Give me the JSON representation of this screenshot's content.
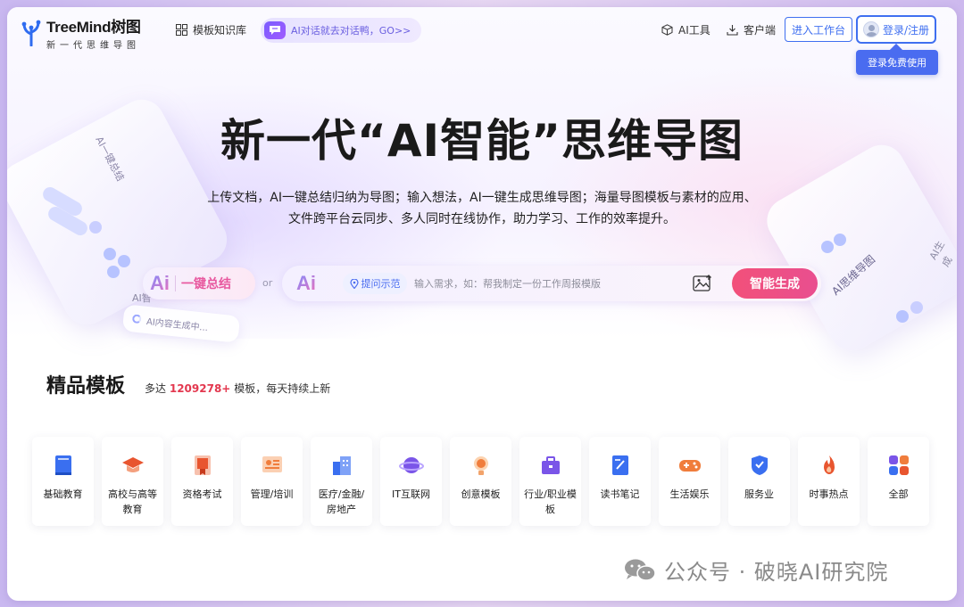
{
  "header": {
    "logo_name": "TreeMind",
    "logo_cn": "树图",
    "logo_tagline": "新一代思维导图",
    "nav_kb": "模板知识库",
    "ai_chat": "AI对话就去对话鸭，GO>>",
    "nav_ai_tools": "AI工具",
    "nav_client": "客户端",
    "workbench_button": "进入工作台",
    "login_button": "登录/注册",
    "login_tooltip": "登录免费使用"
  },
  "decor": {
    "left_card_label": "AI一键总结",
    "left_side_label": "AI智",
    "left_progress": "AI内容生成中...",
    "right_card_label": "AI思维导图",
    "right_side_label": "AI生成"
  },
  "hero": {
    "title": "新一代“AI智能”思维导图",
    "description": "上传文档，AI一键总结归纳为导图；输入想法，AI一键生成思维导图；海量导图模板与素材的应用、文件跨平台云同步、多人同时在线协作，助力学习、工作的效率提升。",
    "summary_button": "一键总结",
    "or": "or",
    "example_chip": "提问示范",
    "search_placeholder": "输入需求，如：帮我制定一份工作周报模版",
    "generate_button": "智能生成",
    "ai_glyph": "Ai"
  },
  "templates": {
    "title": "精品模板",
    "sub_prefix": "多达",
    "count": "1209278+",
    "sub_suffix": "模板，每天持续上新",
    "categories": [
      {
        "label": "基础教育",
        "icon": "book-icon",
        "color": "#3a6ff0"
      },
      {
        "label": "高校与高等教育",
        "icon": "graduation-cap-icon",
        "color": "#e8552f"
      },
      {
        "label": "资格考试",
        "icon": "certificate-icon",
        "color": "#e8552f"
      },
      {
        "label": "管理/培训",
        "icon": "presentation-icon",
        "color": "#f07d3c"
      },
      {
        "label": "医疗/金融/房地产",
        "icon": "buildings-icon",
        "color": "#3a6ff0"
      },
      {
        "label": "IT互联网",
        "icon": "planet-icon",
        "color": "#7a55e8"
      },
      {
        "label": "创意模板",
        "icon": "lightbulb-icon",
        "color": "#f07d3c"
      },
      {
        "label": "行业/职业模板",
        "icon": "briefcase-icon",
        "color": "#7a55e8"
      },
      {
        "label": "读书笔记",
        "icon": "notebook-icon",
        "color": "#3a6ff0"
      },
      {
        "label": "生活娱乐",
        "icon": "gamepad-icon",
        "color": "#f07d3c"
      },
      {
        "label": "服务业",
        "icon": "service-badge-icon",
        "color": "#3a6ff0"
      },
      {
        "label": "时事热点",
        "icon": "flame-icon",
        "color": "#e8552f"
      },
      {
        "label": "全部",
        "icon": "grid-dots-icon",
        "color": "#7a55e8"
      }
    ]
  },
  "watermark": {
    "text": "公众号 · 破晓AI研究院"
  },
  "colors": {
    "brand_blue": "#3f6ff0",
    "generate_pink": "#f2507a",
    "count_red": "#e3384f"
  }
}
